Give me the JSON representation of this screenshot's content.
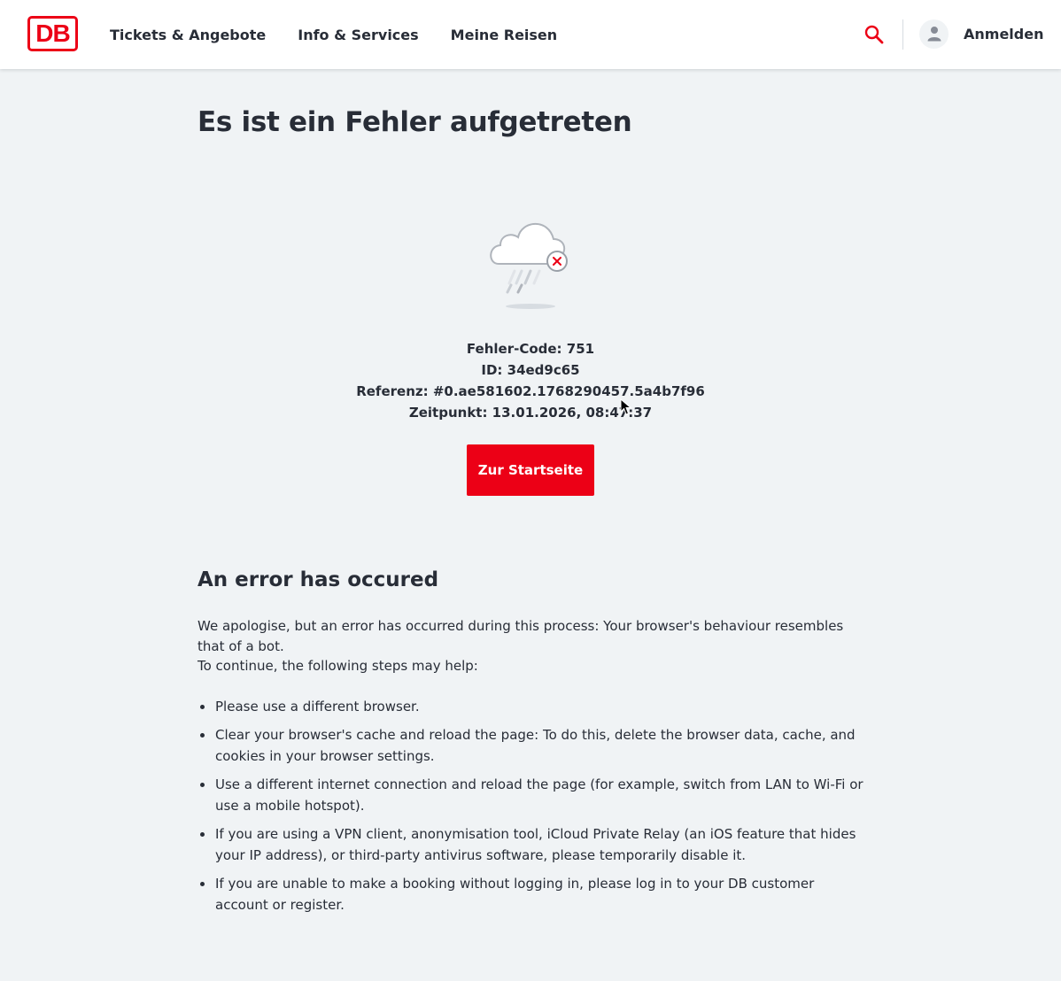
{
  "header": {
    "logo_text": "DB",
    "brand_color": "#ec0016",
    "nav": [
      {
        "label": "Tickets & Angebote"
      },
      {
        "label": "Info & Services"
      },
      {
        "label": "Meine Reisen"
      }
    ],
    "search_icon": "search-icon",
    "avatar_icon": "user-icon",
    "login_label": "Anmelden"
  },
  "error": {
    "title": "Es ist ein Fehler aufgetreten",
    "illustration_icon": "cloud-error-icon",
    "code_line": "Fehler-Code: 751",
    "id_line": "ID: 34ed9c65",
    "reference_line": "Referenz: #0.ae581602.1768290457.5a4b7f96",
    "time_line": "Zeitpunkt: 13.01.2026, 08:47:37",
    "home_button": "Zur Startseite"
  },
  "english": {
    "title": "An error has occured",
    "intro_1": "We apologise, but an error has occurred during this process: Your browser's behaviour resembles that of a bot.",
    "intro_2": "To continue, the following steps may help:",
    "steps": [
      "Please use a different browser.",
      "Clear your browser's cache and reload the page: To do this, delete the browser data, cache, and cookies in your browser settings.",
      "Use a different internet connection and reload the page (for example, switch from LAN to Wi-Fi or use a mobile hotspot).",
      "If you are using a VPN client, anonymisation tool, iCloud Private Relay (an iOS feature that hides your IP address), or third-party antivirus software, please temporarily disable it.",
      "If you are unable to make a booking without logging in, please log in to your DB customer account or register."
    ]
  }
}
